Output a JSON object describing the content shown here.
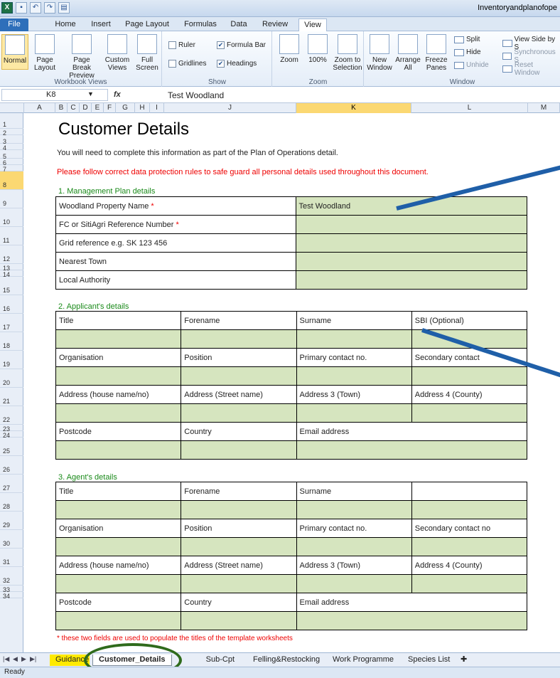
{
  "window": {
    "title": "Inventoryandplanofope"
  },
  "ribbon_tabs": [
    "File",
    "Home",
    "Insert",
    "Page Layout",
    "Formulas",
    "Data",
    "Review",
    "View"
  ],
  "groups": {
    "workbook_views": {
      "label": "Workbook Views",
      "items": [
        "Normal",
        "Page Layout",
        "Page Break Preview",
        "Custom Views",
        "Full Screen"
      ]
    },
    "show": {
      "label": "Show",
      "items": [
        "Ruler",
        "Formula Bar",
        "Gridlines",
        "Headings"
      ],
      "checked": [
        false,
        true,
        false,
        true
      ]
    },
    "zoom": {
      "label": "Zoom",
      "items": [
        "Zoom",
        "100%",
        "Zoom to Selection"
      ]
    },
    "window": {
      "label": "Window",
      "items": [
        "New Window",
        "Arrange All",
        "Freeze Panes",
        "Split",
        "Hide",
        "Unhide",
        "View Side by S",
        "Synchronous S",
        "Reset Window"
      ]
    }
  },
  "formula_bar": {
    "name_box": "K8",
    "fx": "fx",
    "value": "Test Woodland"
  },
  "columns": [
    "A",
    "B",
    "C",
    "D",
    "E",
    "F",
    "G",
    "H",
    "I",
    "J",
    "K",
    "L",
    "M"
  ],
  "rows": [
    "1",
    "2",
    "3",
    "4",
    "5",
    "6",
    "7",
    "8",
    "9",
    "10",
    "11",
    "12",
    "13",
    "14",
    "15",
    "16",
    "17",
    "18",
    "19",
    "20",
    "21",
    "22",
    "23",
    "24",
    "25",
    "26",
    "27",
    "28",
    "29",
    "30",
    "31",
    "32",
    "33",
    "34"
  ],
  "sheet": {
    "title": "Customer Details",
    "intro": "You will need to complete this information as part of the Plan of Operations detail.",
    "warning": "Please follow correct data protection rules to safe guard all personal details used throughout this document.",
    "section1": {
      "title": "1. Management Plan details",
      "rows": [
        {
          "label": "Woodland Property Name ",
          "star": "*",
          "value": "Test Woodland"
        },
        {
          "label": "FC or SitiAgri Reference Number ",
          "star": "*",
          "value": ""
        },
        {
          "label": "Grid reference e.g. SK 123 456",
          "star": "",
          "value": ""
        },
        {
          "label": "Nearest Town",
          "star": "",
          "value": ""
        },
        {
          "label": "Local Authority",
          "star": "",
          "value": ""
        }
      ]
    },
    "section2": {
      "title": "2. Applicant's details",
      "label_rows": [
        [
          "Title",
          "Forename",
          "Surname",
          "SBI (Optional)"
        ],
        [
          "Organisation",
          "Position",
          "Primary contact no.",
          "Secondary contact"
        ],
        [
          "Address (house name/no)",
          "Address (Street name)",
          "Address 3 (Town)",
          "Address 4 (County)"
        ],
        [
          "Postcode",
          "Country",
          "Email address",
          ""
        ]
      ]
    },
    "section3": {
      "title": "3. Agent's details",
      "label_rows": [
        [
          "Title",
          "Forename",
          "Surname",
          ""
        ],
        [
          "Organisation",
          "Position",
          "Primary contact no.",
          "Secondary contact no"
        ],
        [
          "Address (house name/no)",
          "Address (Street name)",
          "Address 3 (Town)",
          "Address 4 (County)"
        ],
        [
          "Postcode",
          "Country",
          "Email address",
          ""
        ]
      ]
    },
    "footnote": "* these two fields are used to populate the titles of the template worksheets"
  },
  "sheet_tabs": [
    "Guidance",
    "Customer_Details",
    "Sub-Cpt Record",
    "Felling&Restocking",
    "Work Programme",
    "Species List"
  ],
  "status": "Ready",
  "colors": {
    "input_fill": "#d6e5bf",
    "warning": "#e00000",
    "section": "#1a8a1a",
    "arrow": "#1f5fa8",
    "ring": "#2f6b1c",
    "active_tab": "#ffea00"
  }
}
